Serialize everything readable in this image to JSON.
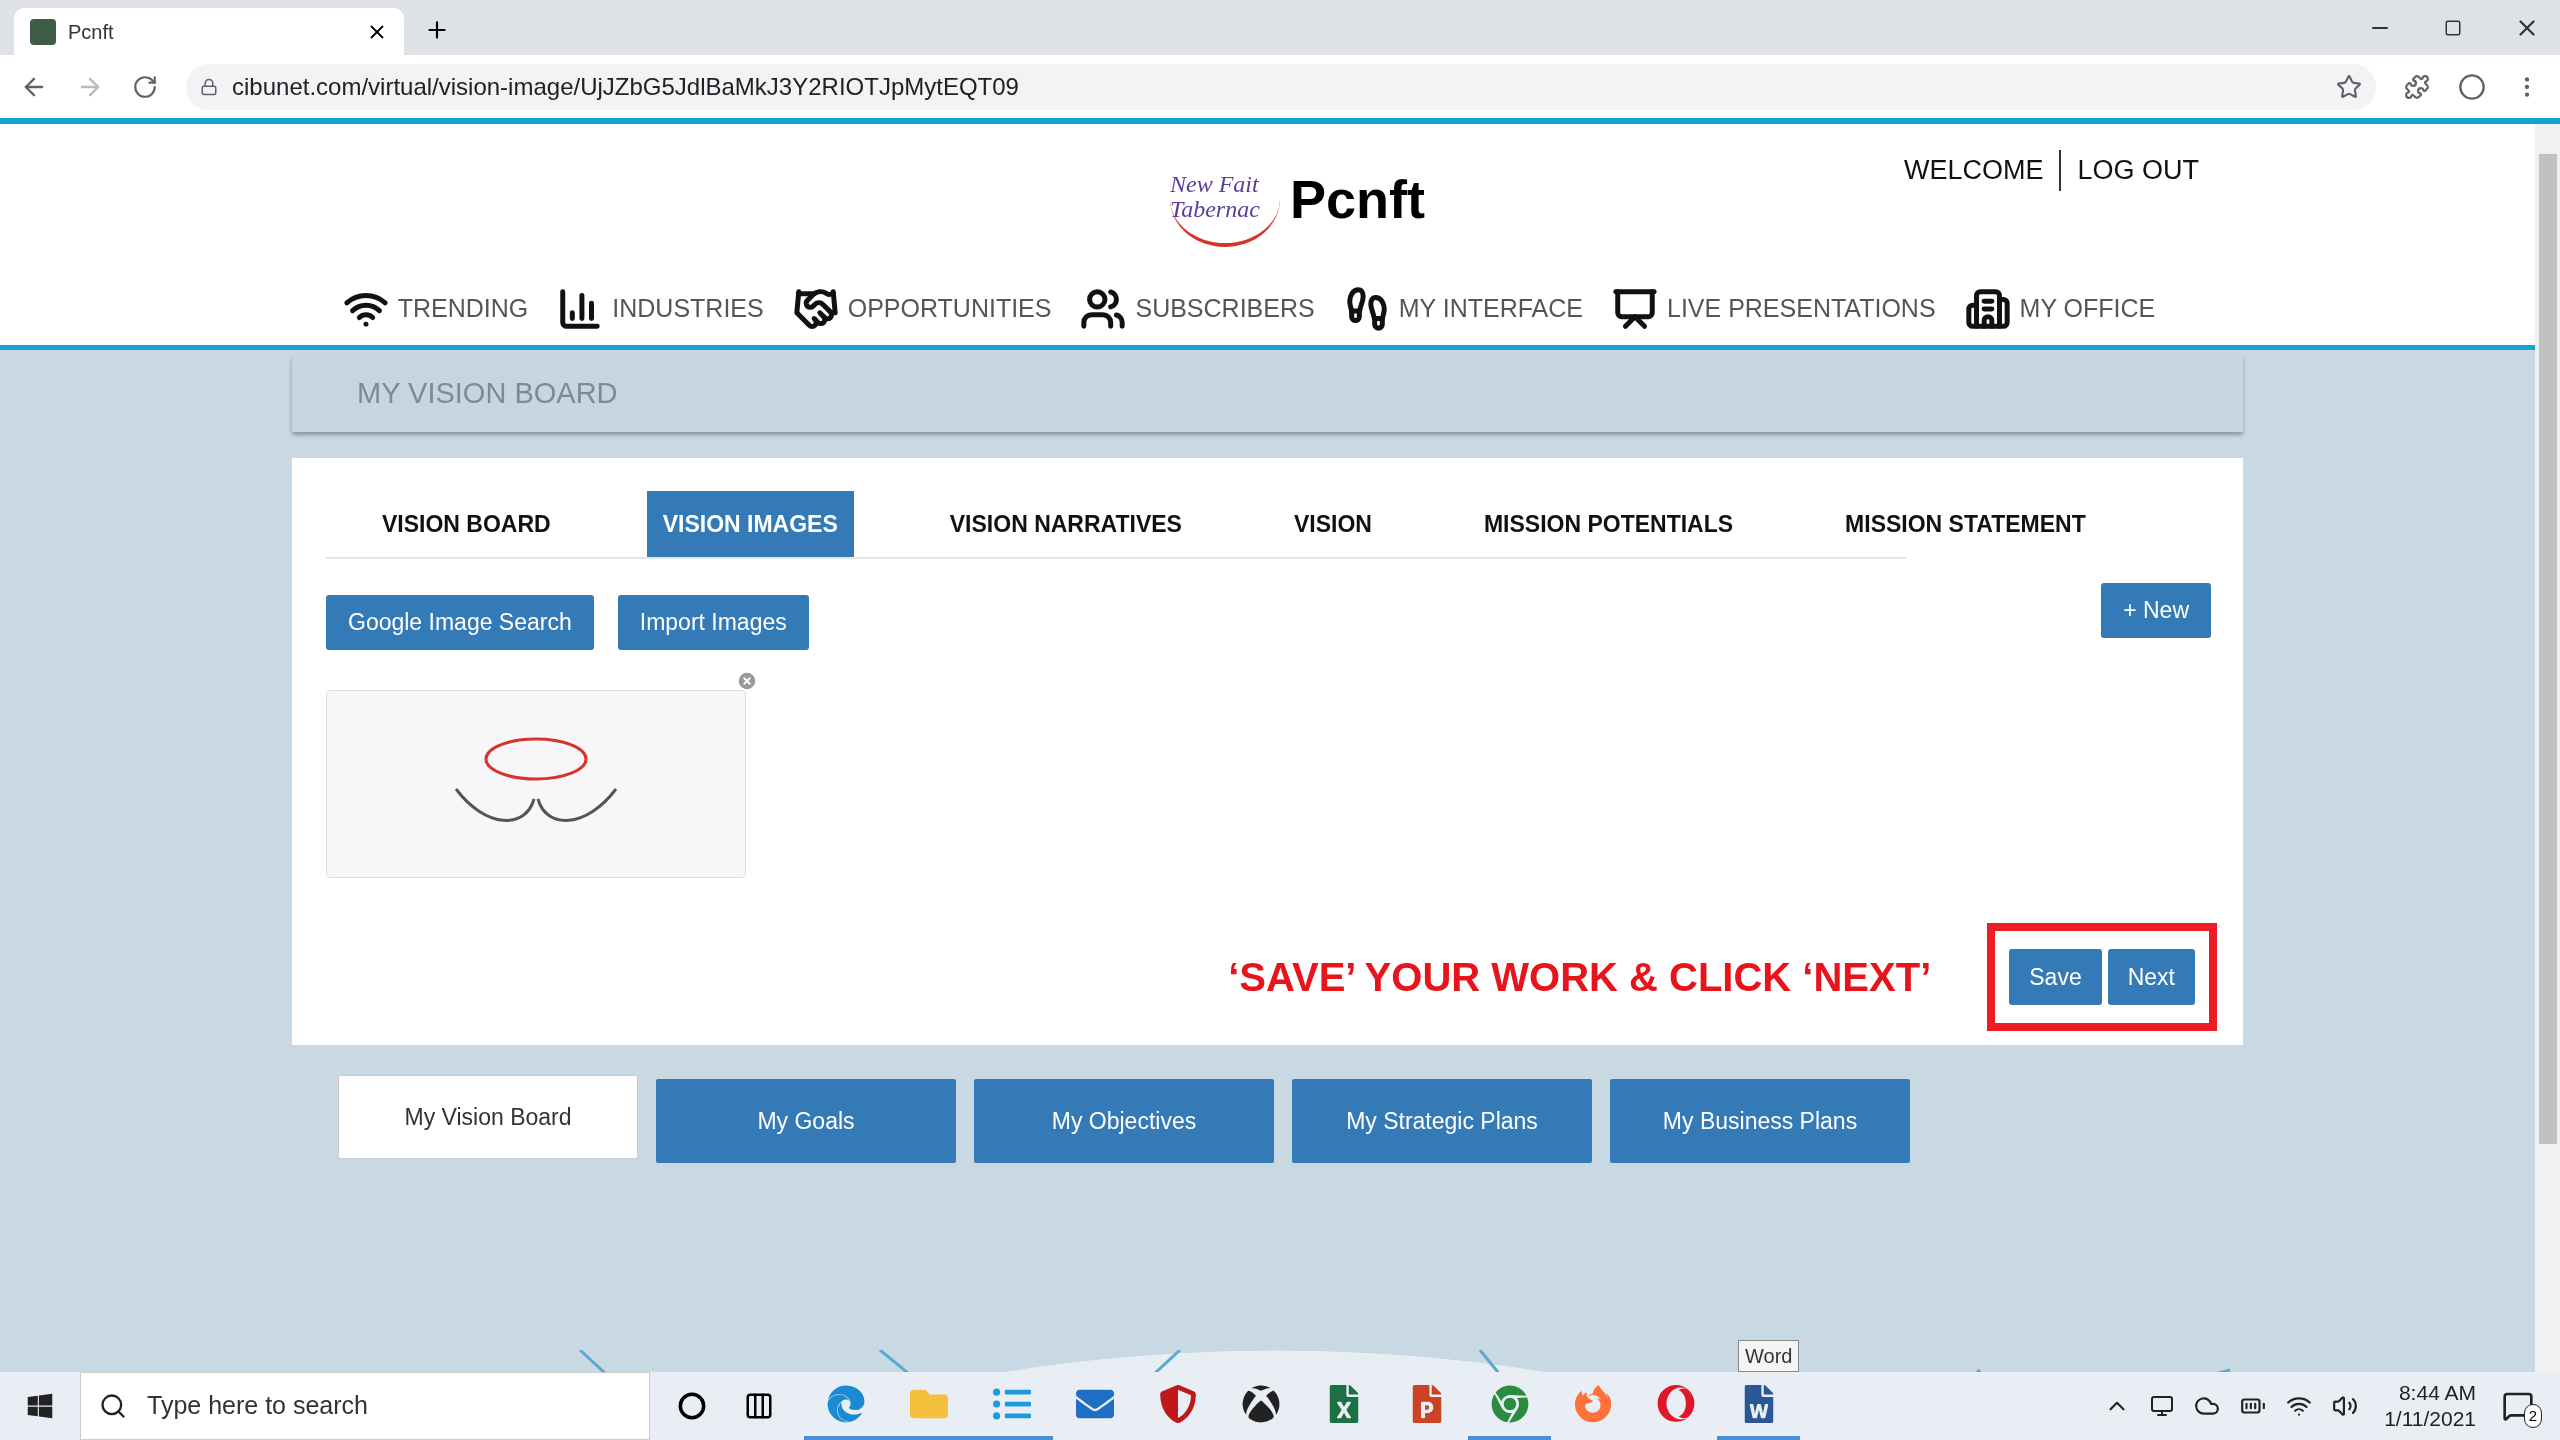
{
  "browser": {
    "tab_title": "Pcnft",
    "url": "cibunet.com/virtual/vision-image/UjJZbG5JdlBaMkJ3Y2RIOTJpMytEQT09"
  },
  "header": {
    "logo_lines": [
      "New Fait",
      "Tabernac"
    ],
    "brand": "Pcnft",
    "user_links": [
      "WELCOME",
      "LOG OUT"
    ],
    "nav": [
      {
        "kind": "wifi",
        "label": "TRENDING"
      },
      {
        "kind": "chart",
        "label": "INDUSTRIES"
      },
      {
        "kind": "handshake",
        "label": "OPPORTUNITIES"
      },
      {
        "kind": "people",
        "label": "SUBSCRIBERS"
      },
      {
        "kind": "steps",
        "label": "MY INTERFACE"
      },
      {
        "kind": "presentation",
        "label": "LIVE PRESENTATIONS"
      },
      {
        "kind": "building",
        "label": "MY OFFICE"
      }
    ]
  },
  "page_title": "MY VISION BOARD",
  "tabs": [
    {
      "label": "VISION BOARD",
      "selected": false
    },
    {
      "label": "VISION IMAGES",
      "selected": true
    },
    {
      "label": "VISION NARRATIVES",
      "selected": false
    },
    {
      "label": "VISION",
      "selected": false
    },
    {
      "label": "MISSION POTENTIALS",
      "selected": false
    },
    {
      "label": "MISSION STATEMENT",
      "selected": false
    }
  ],
  "toolbar": [
    "Google Image Search",
    "Import Images"
  ],
  "new_button": "+ New",
  "images": [
    {
      "kind": "flyer"
    }
  ],
  "instruction": "‘SAVE’ YOUR WORK & CLICK ‘NEXT’",
  "actions": [
    "Save",
    "Next"
  ],
  "bottom_nav": [
    {
      "label": "My Vision Board",
      "selected": true
    },
    {
      "label": "My Goals",
      "selected": false
    },
    {
      "label": "My Objectives",
      "selected": false
    },
    {
      "label": "My Strategic Plans",
      "selected": false
    },
    {
      "label": "My Business Plans",
      "selected": false
    }
  ],
  "tooltip": "Word",
  "taskbar": {
    "search_placeholder": "Type here to search",
    "apps": [
      {
        "kind": "edge",
        "open": true
      },
      {
        "kind": "explorer",
        "open": true
      },
      {
        "kind": "launcher",
        "open": true
      },
      {
        "kind": "mail",
        "open": false
      },
      {
        "kind": "shield",
        "open": false
      },
      {
        "kind": "xbox",
        "open": false
      },
      {
        "kind": "excel",
        "open": false
      },
      {
        "kind": "powerpoint",
        "open": false
      },
      {
        "kind": "chrome",
        "open": true
      },
      {
        "kind": "firefox",
        "open": false
      },
      {
        "kind": "opera",
        "open": false
      },
      {
        "kind": "word",
        "open": true
      }
    ],
    "time": "8:44 AM",
    "date": "1/11/2021",
    "notifications": "2"
  }
}
